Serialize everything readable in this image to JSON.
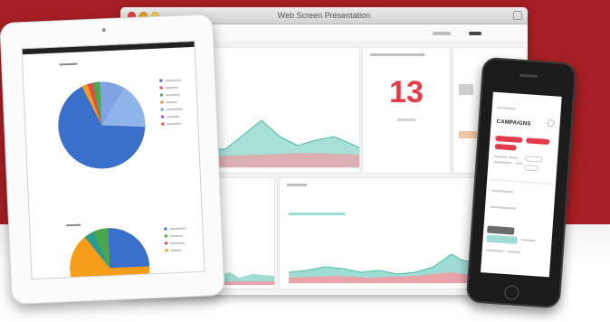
{
  "window": {
    "title": "Web Screen Presentation"
  },
  "dashboard": {
    "counter_panel": {
      "value": "13"
    }
  },
  "phone": {
    "app_title": "CAMPAIGNS"
  },
  "colors": {
    "background_band": "#a61f24",
    "accent_red": "#e23b4a",
    "teal": "#9fdcd3",
    "pink": "#e9a3a9",
    "pie_blue": "#3a6fcc",
    "pie_orange": "#f59c1a",
    "pie_green": "#4aa84a"
  },
  "icons": [
    "close-icon",
    "minimize-icon",
    "maximize-icon",
    "resize-icon"
  ]
}
